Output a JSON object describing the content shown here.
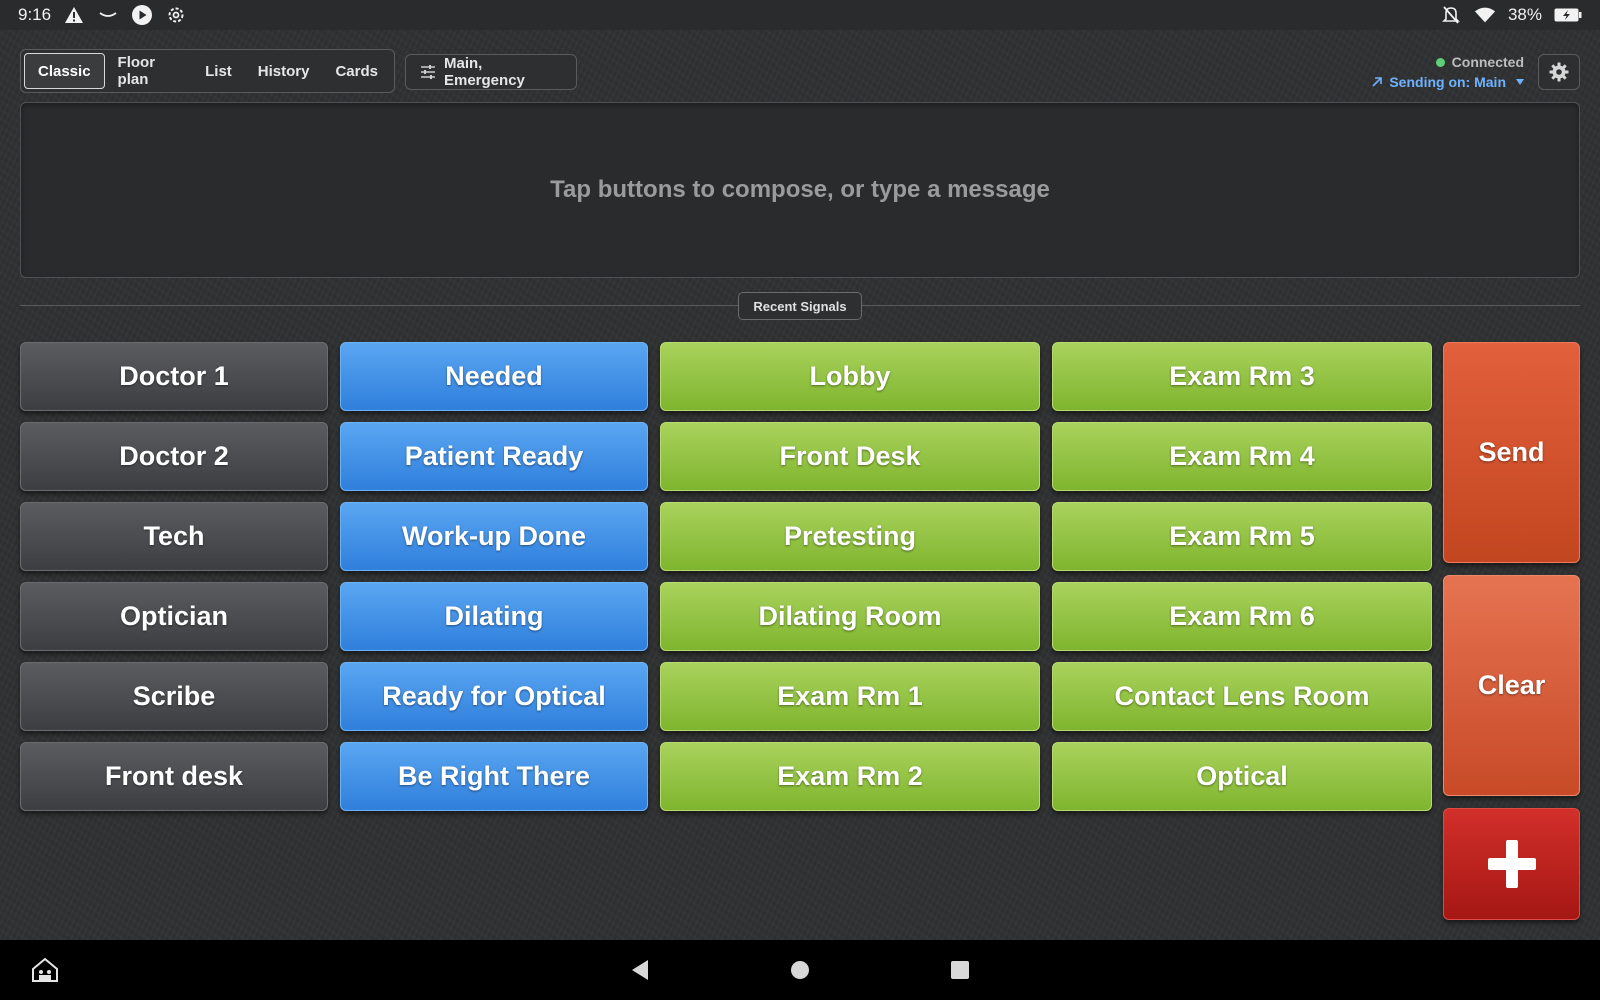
{
  "status_bar": {
    "time": "9:16",
    "battery": "38%"
  },
  "view_tabs": [
    {
      "label": "Classic",
      "active": true
    },
    {
      "label": "Floor plan",
      "active": false
    },
    {
      "label": "List",
      "active": false
    },
    {
      "label": "History",
      "active": false
    },
    {
      "label": "Cards",
      "active": false
    }
  ],
  "filter": {
    "label": "Main, Emergency",
    "icon": "sliders-icon"
  },
  "connection": {
    "status": "Connected",
    "status_color": "#5fd07a",
    "sending": "Sending on: Main"
  },
  "compose": {
    "placeholder": "Tap buttons to compose, or type a message"
  },
  "recent_signals": {
    "label": "Recent Signals"
  },
  "buttons": {
    "people": [
      "Doctor 1",
      "Doctor 2",
      "Tech",
      "Optician",
      "Scribe",
      "Front desk"
    ],
    "statuses": [
      "Needed",
      "Patient Ready",
      "Work-up Done",
      "Dilating",
      "Ready for Optical",
      "Be Right There"
    ],
    "locations_a": [
      "Lobby",
      "Front Desk",
      "Pretesting",
      "Dilating Room",
      "Exam Rm 1",
      "Exam Rm 2"
    ],
    "locations_b": [
      "Exam Rm 3",
      "Exam Rm 4",
      "Exam Rm 5",
      "Exam Rm 6",
      "Contact Lens Room",
      "Optical"
    ]
  },
  "actions": {
    "send": "Send",
    "clear": "Clear",
    "emergency_icon": "plus-icon"
  },
  "colors": {
    "gray": "#4c4d50",
    "blue": "#3f8fe6",
    "green": "#93c243",
    "send": "#d2532d",
    "clear": "#d85f3c",
    "emergency": "#bb2420"
  }
}
